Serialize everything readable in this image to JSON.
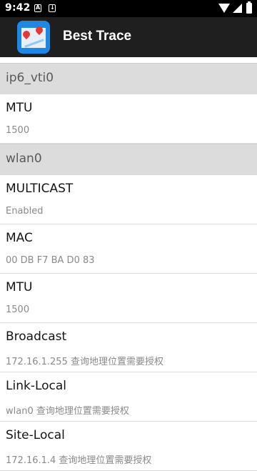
{
  "status_bar": {
    "time": "9:42",
    "icons": [
      "a-notification-icon",
      "download-notification-icon",
      "wifi-icon",
      "signal-icon",
      "battery-icon"
    ]
  },
  "app_bar": {
    "title": "Best Trace",
    "icon": "map-pins-icon"
  },
  "list": {
    "sections": [
      {
        "name": "ip6_vti0",
        "items": [
          {
            "title": "MTU",
            "value": "1500"
          }
        ]
      },
      {
        "name": "wlan0",
        "items": [
          {
            "title": "MULTICAST",
            "value": "Enabled"
          },
          {
            "title": "MAC",
            "value": "00 DB F7 BA D0 83"
          },
          {
            "title": "MTU",
            "value": "1500"
          },
          {
            "title": "Broadcast",
            "value": "172.16.1.255 查询地理位置需要授权"
          },
          {
            "title": "Link-Local",
            "value": "wlan0 查询地理位置需要授权"
          },
          {
            "title": "Site-Local",
            "value": "172.16.1.4 查询地理位置需要授权"
          }
        ]
      }
    ]
  },
  "colors": {
    "status_bar": "#000000",
    "app_bar": "#1f1f1f",
    "section_header": "#dcdcdc",
    "app_icon": "#1e88e5",
    "pin": "#e53935"
  }
}
